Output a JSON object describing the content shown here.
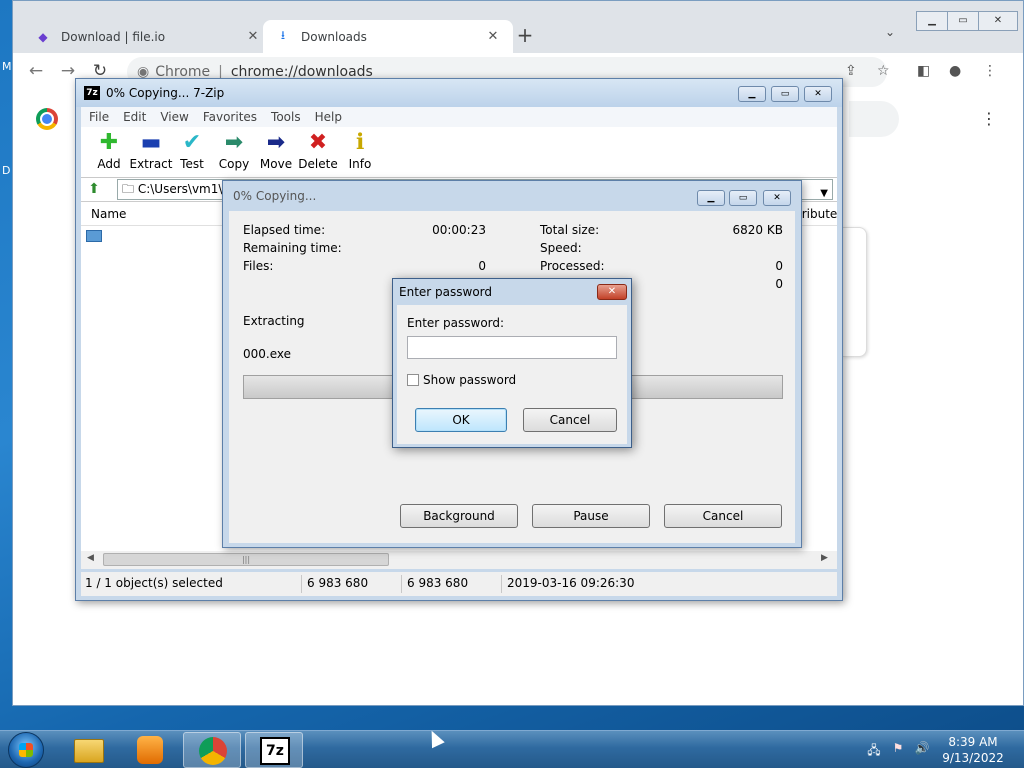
{
  "desktop": {
    "glyph_top": "M",
    "glyph_mid": "D"
  },
  "browser": {
    "tabs": [
      {
        "title": "Download | file.io",
        "icon": "file-io-icon"
      },
      {
        "title": "Downloads",
        "icon": "download-icon"
      }
    ],
    "omnibox": {
      "site": "Chrome",
      "url": "chrome://downloads"
    }
  },
  "sevenzip": {
    "window_title": "0% Copying... 7-Zip",
    "menu": [
      "File",
      "Edit",
      "View",
      "Favorites",
      "Tools",
      "Help"
    ],
    "toolbar": [
      {
        "label": "Add",
        "icon": "add-plus-icon",
        "glyph": "✚",
        "color": "#2fb82f"
      },
      {
        "label": "Extract",
        "icon": "extract-minus-icon",
        "glyph": "▬",
        "color": "#1a3fb0"
      },
      {
        "label": "Test",
        "icon": "test-check-icon",
        "glyph": "✔",
        "color": "#2ab7c8"
      },
      {
        "label": "Copy",
        "icon": "copy-arrow-icon",
        "glyph": "➡",
        "color": "#2a8a6a"
      },
      {
        "label": "Move",
        "icon": "move-arrow-icon",
        "glyph": "➡",
        "color": "#1a2a8a"
      },
      {
        "label": "Delete",
        "icon": "delete-x-icon",
        "glyph": "✖",
        "color": "#d02020"
      },
      {
        "label": "Info",
        "icon": "info-icon",
        "glyph": "ℹ",
        "color": "#c8a800"
      }
    ],
    "path": "C:\\Users\\vm1\\D",
    "columns": {
      "name": "Name",
      "attributes": "tribute"
    },
    "status": {
      "selection": "1 / 1 object(s) selected",
      "size": "6 983 680",
      "packed": "6 983 680",
      "modified": "2019-03-16 09:26:30"
    }
  },
  "progress": {
    "title": "0% Copying...",
    "elapsed_label": "Elapsed time:",
    "elapsed_value": "00:00:23",
    "remaining_label": "Remaining time:",
    "files_label": "Files:",
    "files_value": "0",
    "total_label": "Total size:",
    "total_value": "6820 KB",
    "speed_label": "Speed:",
    "processed_label": "Processed:",
    "processed_value": "0",
    "extra_value": "0",
    "action": "Extracting",
    "current_file": "000.exe",
    "progress_fraction": 0,
    "buttons": {
      "background": "Background",
      "pause": "Pause",
      "cancel": "Cancel"
    }
  },
  "password_dialog": {
    "title": "Enter password",
    "label": "Enter password:",
    "value": "",
    "show_password": "Show password",
    "ok": "OK",
    "cancel": "Cancel"
  },
  "taskbar": {
    "time": "8:39 AM",
    "date": "9/13/2022",
    "apps": [
      "explorer-icon",
      "media-player-icon",
      "chrome-icon",
      "7zip-icon"
    ]
  }
}
